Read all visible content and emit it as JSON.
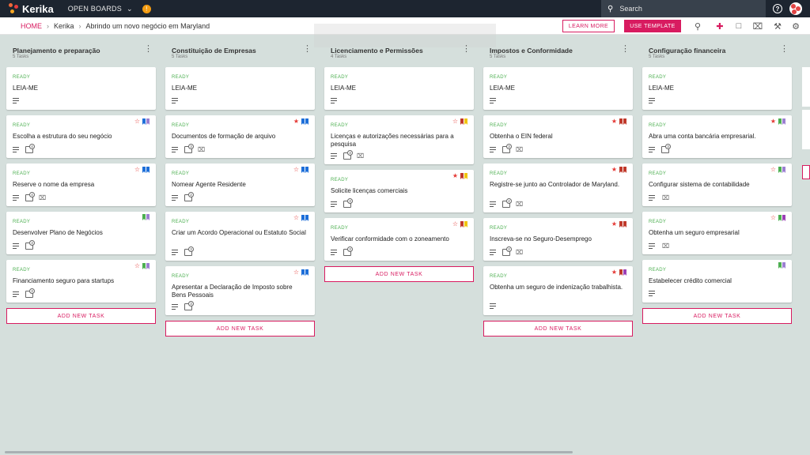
{
  "app": {
    "logo_text": "Kerika",
    "open_boards_label": "OPEN BOARDS",
    "notification_count": "!",
    "search_placeholder": "Search",
    "accent_color": "#d81b60"
  },
  "breadcrumb": {
    "home": "HOME",
    "org": "Kerika",
    "board": "Abrindo um novo negócio em Maryland"
  },
  "actions": {
    "learn_more": "LEARN MORE",
    "use_template": "USE TEMPLATE"
  },
  "toolbar_icons": [
    "search-icon",
    "add-person-icon",
    "chat-icon",
    "attachment-icon",
    "tools-icon",
    "settings-icon"
  ],
  "columns": [
    {
      "title": "Planejamento e preparação",
      "count": "5 Tasks",
      "add_label": "ADD NEW TASK",
      "cards": [
        {
          "status": "READY",
          "title": "LEIA-ME",
          "star": "",
          "tags": [],
          "checklist": "",
          "attach": false
        },
        {
          "status": "READY",
          "title": "Escolha a estrutura do seu negócio",
          "star": "outline",
          "tags": [
            "#1e6fd9",
            "#9b7fd1"
          ],
          "checklist": "4",
          "attach": false
        },
        {
          "status": "READY",
          "title": "Reserve o nome da empresa",
          "star": "outline",
          "tags": [
            "#1e6fd9",
            "#1e6fd9"
          ],
          "checklist": "4",
          "attach": true
        },
        {
          "status": "READY",
          "title": "Desenvolver Plano de Negócios",
          "star": "",
          "tags": [
            "#4caf50",
            "#9b7fd1"
          ],
          "checklist": "3",
          "attach": false
        },
        {
          "status": "READY",
          "title": "Financiamento seguro para startups",
          "star": "outline",
          "tags": [
            "#4caf50",
            "#9b7fd1"
          ],
          "checklist": "3",
          "attach": false
        }
      ]
    },
    {
      "title": "Constituição de Empresas",
      "count": "5 Tasks",
      "add_label": "ADD NEW TASK",
      "cards": [
        {
          "status": "READY",
          "title": "LEIA-ME",
          "star": "",
          "tags": [],
          "checklist": "",
          "attach": false
        },
        {
          "status": "READY",
          "title": "Documentos de formação de arquivo",
          "star": "filled",
          "tags": [
            "#1e6fd9",
            "#1e6fd9"
          ],
          "checklist": "3",
          "attach": true
        },
        {
          "status": "READY",
          "title": "Nomear Agente Residente",
          "star": "outline",
          "tags": [
            "#1e6fd9",
            "#1e6fd9"
          ],
          "checklist": "2",
          "attach": false
        },
        {
          "status": "READY",
          "title": "Criar um Acordo Operacional ou Estatuto Social",
          "star": "outline",
          "tags": [
            "#1e6fd9",
            "#1e6fd9"
          ],
          "checklist": "3",
          "attach": false
        },
        {
          "status": "READY",
          "title": "Apresentar a Declaração de Imposto sobre Bens Pessoais",
          "star": "outline",
          "tags": [
            "#1e6fd9",
            "#1e6fd9"
          ],
          "checklist": "3",
          "attach": false
        }
      ]
    },
    {
      "title": "Licenciamento e Permissões",
      "count": "4 Tasks",
      "add_label": "ADD NEW TASK",
      "cards": [
        {
          "status": "READY",
          "title": "LEIA-ME",
          "star": "",
          "tags": [],
          "checklist": "",
          "attach": false
        },
        {
          "status": "READY",
          "title": "Licenças e autorizações necessárias para a pesquisa",
          "star": "outline",
          "tags": [
            "#c0392b",
            "#f1c40f"
          ],
          "checklist": "3",
          "attach": true
        },
        {
          "status": "READY",
          "title": "Solicite licenças comerciais",
          "star": "filled",
          "tags": [
            "#c0392b",
            "#f1c40f"
          ],
          "checklist": "3",
          "attach": false
        },
        {
          "status": "READY",
          "title": "Verificar conformidade com o zoneamento",
          "star": "outline",
          "tags": [
            "#c0392b",
            "#f1c40f"
          ],
          "checklist": "3",
          "attach": false
        }
      ]
    },
    {
      "title": "Impostos e Conformidade",
      "count": "5 Tasks",
      "add_label": "ADD NEW TASK",
      "cards": [
        {
          "status": "READY",
          "title": "LEIA-ME",
          "star": "",
          "tags": [],
          "checklist": "",
          "attach": false
        },
        {
          "status": "READY",
          "title": "Obtenha o EIN federal",
          "star": "filled",
          "tags": [
            "#c0392b",
            "#c0392b"
          ],
          "checklist": "3",
          "attach": true
        },
        {
          "status": "READY",
          "title": "Registre-se junto ao Controlador de Maryland.",
          "star": "filled",
          "tags": [
            "#c0392b",
            "#c0392b"
          ],
          "checklist": "2",
          "attach": true
        },
        {
          "status": "READY",
          "title": "Inscreva-se no Seguro-Desemprego",
          "star": "filled",
          "tags": [
            "#c0392b",
            "#c0392b"
          ],
          "checklist": "2",
          "attach": true
        },
        {
          "status": "READY",
          "title": "Obtenha um seguro de indenização trabalhista.",
          "star": "filled",
          "tags": [
            "#c0392b",
            "#9b3fb5"
          ],
          "checklist": "",
          "attach": false
        }
      ]
    },
    {
      "title": "Configuração financeira",
      "count": "5 Tasks",
      "add_label": "ADD NEW TASK",
      "cards": [
        {
          "status": "READY",
          "title": "LEIA-ME",
          "star": "",
          "tags": [],
          "checklist": "",
          "attach": false
        },
        {
          "status": "READY",
          "title": "Abra uma conta bancária empresarial.",
          "star": "filled",
          "tags": [
            "#4caf50",
            "#9b7fd1"
          ],
          "checklist": "3",
          "attach": false
        },
        {
          "status": "READY",
          "title": "Configurar sistema de contabilidade",
          "star": "outline",
          "tags": [
            "#4caf50",
            "#9b7fd1"
          ],
          "checklist": "",
          "attach": true
        },
        {
          "status": "READY",
          "title": "Obtenha um seguro empresarial",
          "star": "outline",
          "tags": [
            "#4caf50",
            "#9b3fb5"
          ],
          "checklist": "",
          "attach": true
        },
        {
          "status": "READY",
          "title": "Estabelecer crédito comercial",
          "star": "",
          "tags": [
            "#4caf50",
            "#9b7fd1"
          ],
          "checklist": "",
          "attach": false
        }
      ]
    }
  ]
}
